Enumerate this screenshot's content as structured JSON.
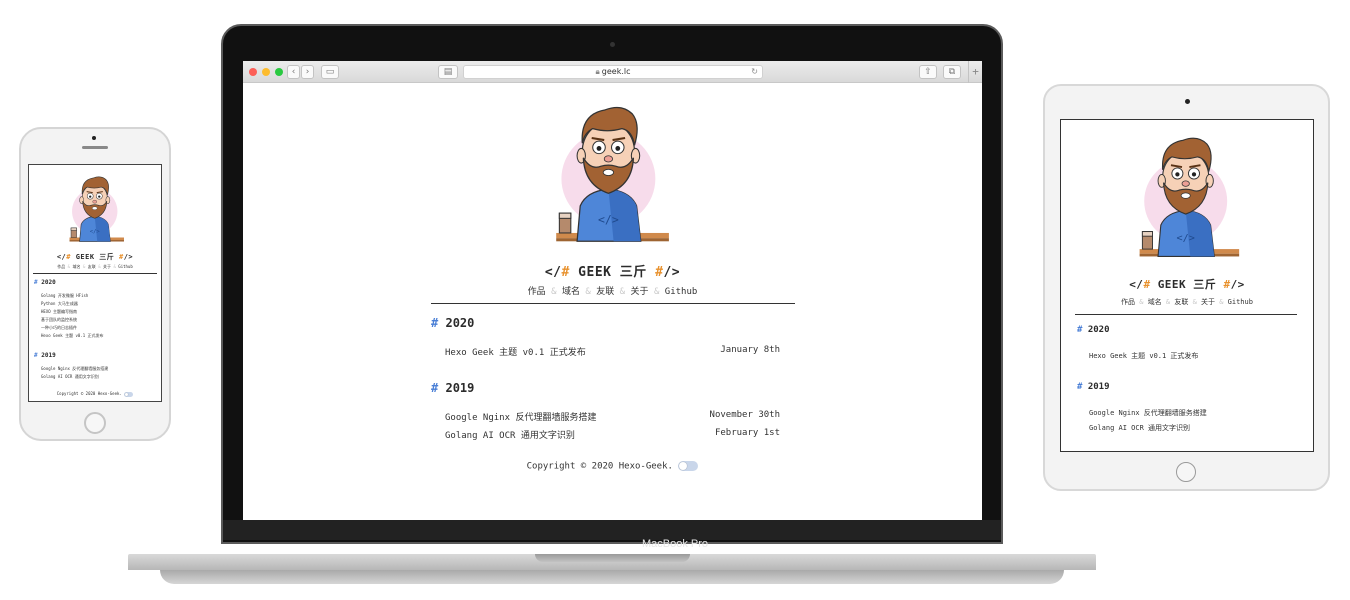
{
  "browser": {
    "url": "geek.lc",
    "laptop_model": "MacBook Pro",
    "traffic_lights": [
      "#fc5f57",
      "#fdbc2e",
      "#29c940"
    ]
  },
  "site": {
    "brand_left": "</",
    "brand_hash": "#",
    "brand_name": "GEEK 三斤",
    "brand_hash_right": "#",
    "brand_right": "/>",
    "nav": [
      "作品",
      "域名",
      "友联",
      "关于",
      "Github"
    ],
    "nav_separator": "&",
    "copyright": "Copyright © 2020 Hexo-Geek."
  },
  "laptop": {
    "years": [
      {
        "year": "2020",
        "posts": [
          {
            "title": "Hexo Geek 主题 v0.1 正式发布",
            "date": "January 8th"
          }
        ]
      },
      {
        "year": "2019",
        "posts": [
          {
            "title": "Google Nginx 反代理翻墙服务搭建",
            "date": "November 30th"
          },
          {
            "title": "Golang AI OCR 通用文字识别",
            "date": "February 1st"
          }
        ]
      }
    ]
  },
  "phone": {
    "years": [
      {
        "year": "2020",
        "posts": [
          {
            "title": "Golang 开发微服 HFish"
          },
          {
            "title": "Python 大马生成器"
          },
          {
            "title": "HEXO 主题编写指南"
          },
          {
            "title": "基于团队的监控系统"
          },
          {
            "title": "一种小巧的日志插件"
          },
          {
            "title": "Hexo Geek 主题 v0.1 正式发布"
          }
        ]
      },
      {
        "year": "2019",
        "posts": [
          {
            "title": "Google Nginx 反代理翻墙服务搭建"
          },
          {
            "title": "Golang AI OCR 通用文字识别"
          }
        ]
      }
    ]
  },
  "tablet": {
    "years": [
      {
        "year": "2020",
        "posts": [
          {
            "title": "Hexo Geek 主题 v0.1 正式发布"
          }
        ]
      },
      {
        "year": "2019",
        "posts": [
          {
            "title": "Google Nginx 反代理翻墙服务搭建"
          },
          {
            "title": "Golang AI OCR 通用文字识别"
          }
        ]
      }
    ]
  },
  "colors": {
    "accent_orange": "#e8912d",
    "accent_blue": "#4a7fd6",
    "toggle": "#c9d6ea"
  }
}
